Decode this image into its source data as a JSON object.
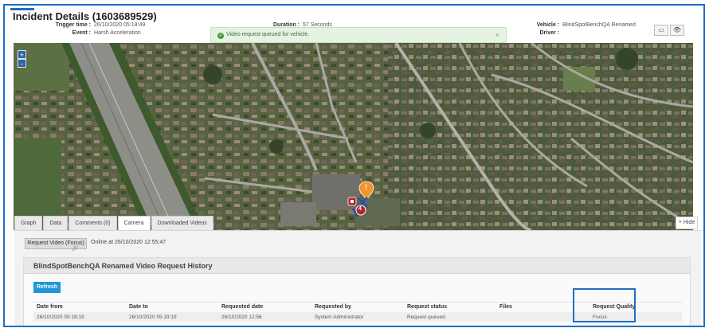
{
  "header": {
    "title": "Incident Details (1603689529)",
    "trigger_time_label": "Trigger time :",
    "trigger_time_value": "26/10/2020 05:18:49",
    "event_label": "Event :",
    "event_value": "Harsh Acceleration",
    "duration_label": "Duration :",
    "duration_value": "57 Seconds",
    "vehicle_label": "Vehicle :",
    "vehicle_value": "BlindSpotBenchQA Renamed",
    "driver_label": "Driver :",
    "driver_value": "",
    "buttons": [
      "▭",
      "👁"
    ]
  },
  "toast": {
    "icon": "check-circle-icon",
    "message": "Video request queued for vehicle.",
    "close": "×"
  },
  "map": {
    "zoom_in": "+",
    "zoom_out": "-",
    "marker_warning": "!",
    "marker_count": "4"
  },
  "tabs": [
    {
      "label": "Graph",
      "active": false
    },
    {
      "label": "Data",
      "active": false
    },
    {
      "label": "Comments (0)",
      "active": false
    },
    {
      "label": "Camera",
      "active": true
    },
    {
      "label": "Downloaded Videos",
      "active": false
    }
  ],
  "hide_label": "˅ Hide",
  "camera": {
    "request_button": "Request Video (Focus)",
    "online_status": "Online at 26/10/2020 12:55:47",
    "history_title": "BlindSpotBenchQA Renamed Video Request History",
    "refresh": "Refresh",
    "columns": [
      "Date from",
      "Date to",
      "Requested date",
      "Requested by",
      "Request status",
      "Files",
      "Request Quality"
    ],
    "rows": [
      [
        "26/10/2020 05:18:19",
        "26/10/2020 05:19:19",
        "26/10/2020 12:56",
        "System Administrator",
        "Request queued",
        "",
        "Focus"
      ]
    ]
  },
  "colors": {
    "accent": "#1f6fc4",
    "refresh": "#2196d8",
    "toast_bg": "#e6f3e3"
  }
}
